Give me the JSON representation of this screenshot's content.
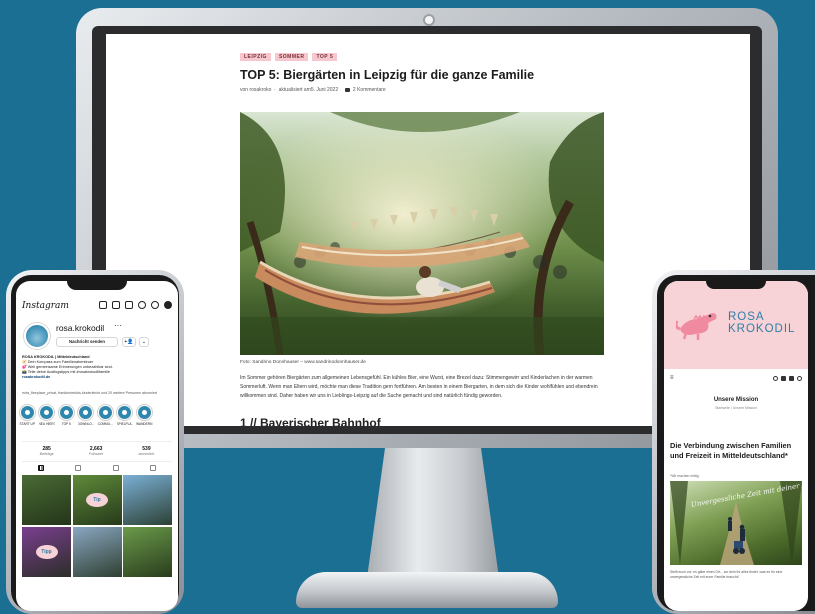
{
  "blog": {
    "tags": [
      "LEIPZIG",
      "SOMMER",
      "TOP 5"
    ],
    "title": "TOP 5: Biergärten in Leipzig für die ganze Familie",
    "meta": {
      "author": "von rosakroko",
      "updated": "aktualisiert am5. Juni 2022",
      "comments": "2 Kommentare"
    },
    "photo_credit": "Foto: Sandrino Donnhauser – www.sandrinodonnhauser.de",
    "paragraph": "Im Sommer gehören Biergärten zum allgemeinen Lebensgefühl. Ein kühles Bier, eine Wurst, eine Brezel dazu: Stimmengewirr und Kinderlachen in der warmen Sommerluft. Wenn man Eltern wird, möchte man diese Tradition gern fortführen. Am besten in einem Biergarten, in dem sich die Kinder wohlfühlen und ebendrein willkommen sind. Daher haben wir uns in Lieblings-Leipzig auf die Suche gemacht und sind natürlich fündig geworden.",
    "heading": "1 // Bayerischer Bahnhof"
  },
  "instagram": {
    "logo": "Instagram",
    "username": "rosa.krokodil",
    "more": "···",
    "message_button": "Nachricht senden",
    "follow_symbol": "+👤",
    "dropdown_symbol": "⌄",
    "bio": {
      "name": "ROSA KROKODIL | Mitteldeutschland",
      "line1": "🧭 Dein Kompass zum Familienabenteuer",
      "line2": "💕 Weil gemeinsame Erinnerungen unbezahlbar sind.",
      "line3": "📸 Teile deine Ausflugstipps mit #rosakrokodilfamilie",
      "link": "rosakrokodil.de"
    },
    "mutual": "mira_fleeplace_privat, frankfurterkids.kinderleicht und 20 weitere Personen abonniert",
    "highlights": [
      "START UP",
      "NEU HIER?",
      "TOP 5",
      "DOWNLO...",
      "COMMU...",
      "SPIELPLA...",
      "WANDERN"
    ],
    "stats": [
      {
        "num": "285",
        "label": "Beiträge"
      },
      {
        "num": "2,663",
        "label": "Follower"
      },
      {
        "num": "539",
        "label": "abonniert"
      }
    ],
    "grid_colors": [
      "#4a6b35",
      "#5f8a3a",
      "#7bb0d6",
      "#7a3f8f",
      "#8aa7c2",
      "#6b9a4a"
    ],
    "grid_overlays": [
      "",
      "Tip",
      "",
      "Tipp",
      "",
      ""
    ]
  },
  "rosa_site": {
    "brand_line1": "ROSA",
    "brand_line2": "KROKODIL",
    "menu_symbol": "≡",
    "mission": "Unsere Mission",
    "breadcrumb": "Startseite / Unsere Mission",
    "headline": "Die Verbindung zwischen Familien und Freizeit in Mitteldeutschland*",
    "footnote": "*Wir machen mittig.",
    "image_text": "Unvergessliche Zeit mit deiner Familie",
    "caption": "Stellt euch vor, es gäbe einen Ort... wo dein Ihr alles findet, was es für eine unvergessliche Zeit mit eurer Familie braucht!"
  }
}
